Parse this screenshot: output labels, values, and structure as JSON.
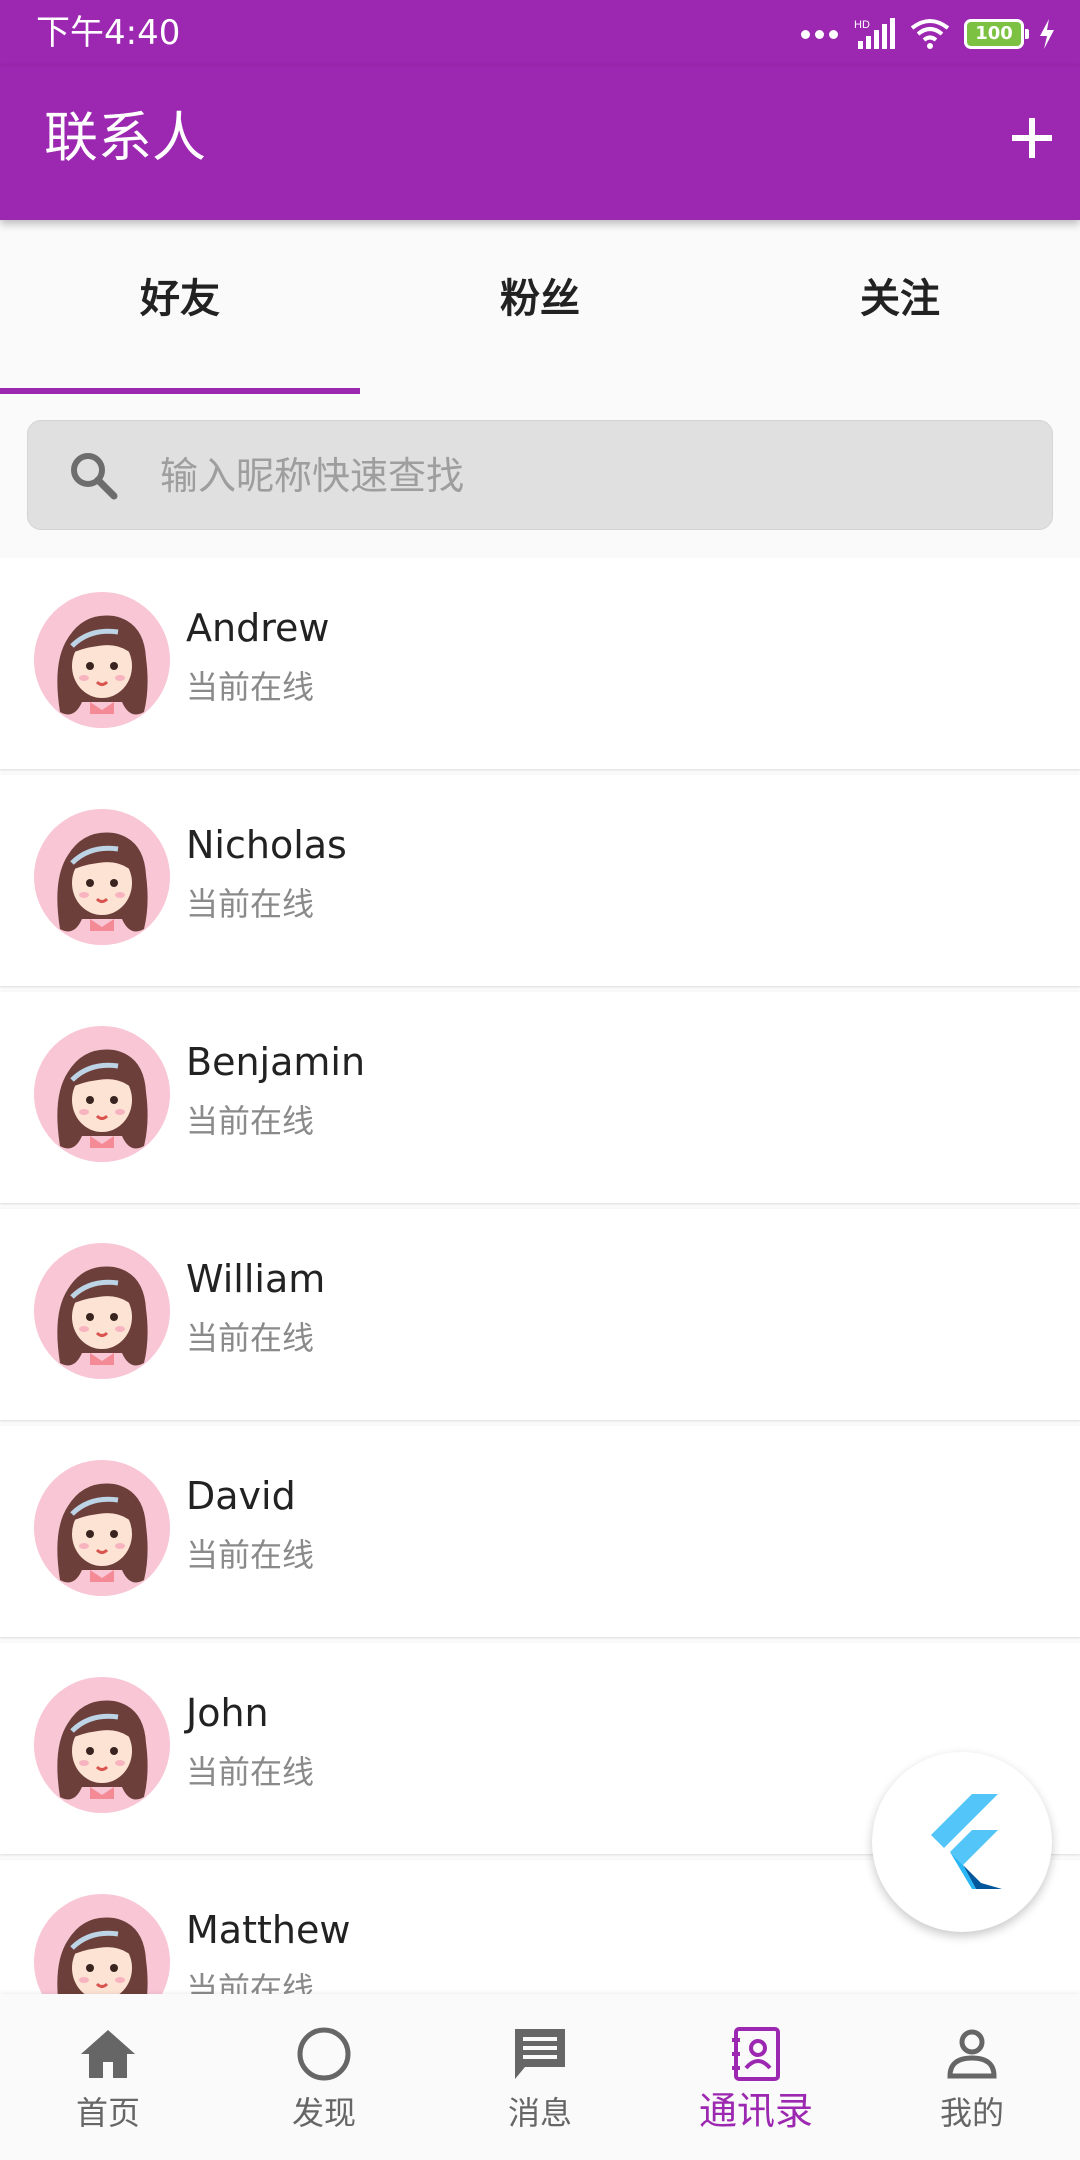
{
  "status_bar": {
    "time": "下午4:40",
    "battery": "100",
    "network_label": "HD"
  },
  "app_bar": {
    "title": "联系人",
    "add_icon": "plus-icon"
  },
  "tabs": [
    {
      "label": "好友",
      "active": true
    },
    {
      "label": "粉丝",
      "active": false
    },
    {
      "label": "关注",
      "active": false
    }
  ],
  "search": {
    "placeholder": "输入昵称快速查找",
    "value": ""
  },
  "contacts": [
    {
      "name": "Andrew",
      "status": "当前在线"
    },
    {
      "name": "Nicholas",
      "status": "当前在线"
    },
    {
      "name": "Benjamin",
      "status": "当前在线"
    },
    {
      "name": "William",
      "status": "当前在线"
    },
    {
      "name": "David",
      "status": "当前在线"
    },
    {
      "name": "John",
      "status": "当前在线"
    },
    {
      "name": "Matthew",
      "status": "当前在线"
    }
  ],
  "bottom_nav": [
    {
      "label": "首页",
      "icon": "home-icon"
    },
    {
      "label": "发现",
      "icon": "circle-icon"
    },
    {
      "label": "消息",
      "icon": "message-icon"
    },
    {
      "label": "通讯录",
      "icon": "contacts-icon",
      "active": true
    },
    {
      "label": "我的",
      "icon": "person-icon"
    }
  ],
  "colors": {
    "primary": "#9c27b0",
    "avatar_bg": "#f9c6d6",
    "inactive": "#666666"
  }
}
